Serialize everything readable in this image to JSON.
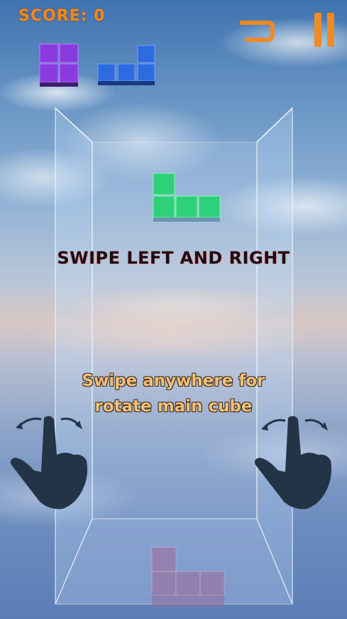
{
  "hud": {
    "score_label": "SCORE: 0",
    "undo_icon": "undo-arrow-icon",
    "pause_icon": "pause-icon"
  },
  "instructions": {
    "title": "SWIPE LEFT AND RIGHT",
    "subtitle_line1": "Swipe anywhere for",
    "subtitle_line2": "rotate main cube"
  },
  "colors": {
    "accent": "#f08a24",
    "purple_block": "#8a3be0",
    "blue_block": "#2f6be0",
    "green_block": "#2fd07a",
    "ghost_block": "#9a7fa8"
  },
  "pieces": {
    "next_piece_1": "purple-square",
    "next_piece_2": "blue-l",
    "falling_piece": "green-l",
    "landed_piece": "ghost-l"
  }
}
